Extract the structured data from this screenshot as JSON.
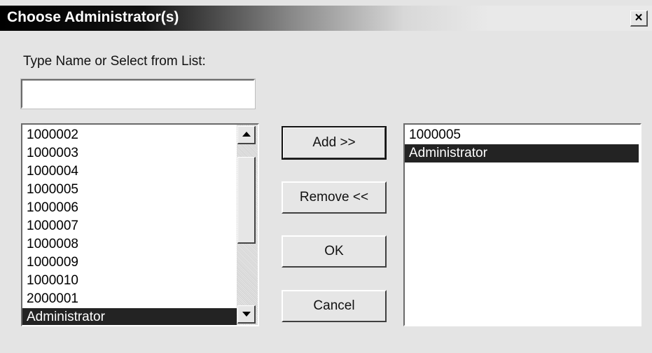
{
  "dialog": {
    "title": "Choose Administrator(s)",
    "close_label": "×"
  },
  "prompt_label": "Type Name or Select from List:",
  "name_input": {
    "value": "",
    "placeholder": ""
  },
  "available_list": {
    "items": [
      {
        "label": "1000002",
        "selected": false
      },
      {
        "label": "1000003",
        "selected": false
      },
      {
        "label": "1000004",
        "selected": false
      },
      {
        "label": "1000005",
        "selected": false
      },
      {
        "label": "1000006",
        "selected": false
      },
      {
        "label": "1000007",
        "selected": false
      },
      {
        "label": "1000008",
        "selected": false
      },
      {
        "label": "1000009",
        "selected": false
      },
      {
        "label": "1000010",
        "selected": false
      },
      {
        "label": "2000001",
        "selected": false
      },
      {
        "label": "Administrator",
        "selected": true
      }
    ]
  },
  "selected_list": {
    "items": [
      {
        "label": "1000005",
        "selected": false
      },
      {
        "label": "Administrator",
        "selected": true
      }
    ]
  },
  "buttons": {
    "add": "Add >>",
    "remove": "Remove <<",
    "ok": "OK",
    "cancel": "Cancel"
  },
  "icons": {
    "close": "close-icon",
    "scroll_up": "chevron-up-icon",
    "scroll_down": "chevron-down-icon"
  },
  "colors": {
    "selection_bg": "#232323",
    "selection_fg": "#ffffff",
    "dialog_bg": "#e4e4e4"
  }
}
